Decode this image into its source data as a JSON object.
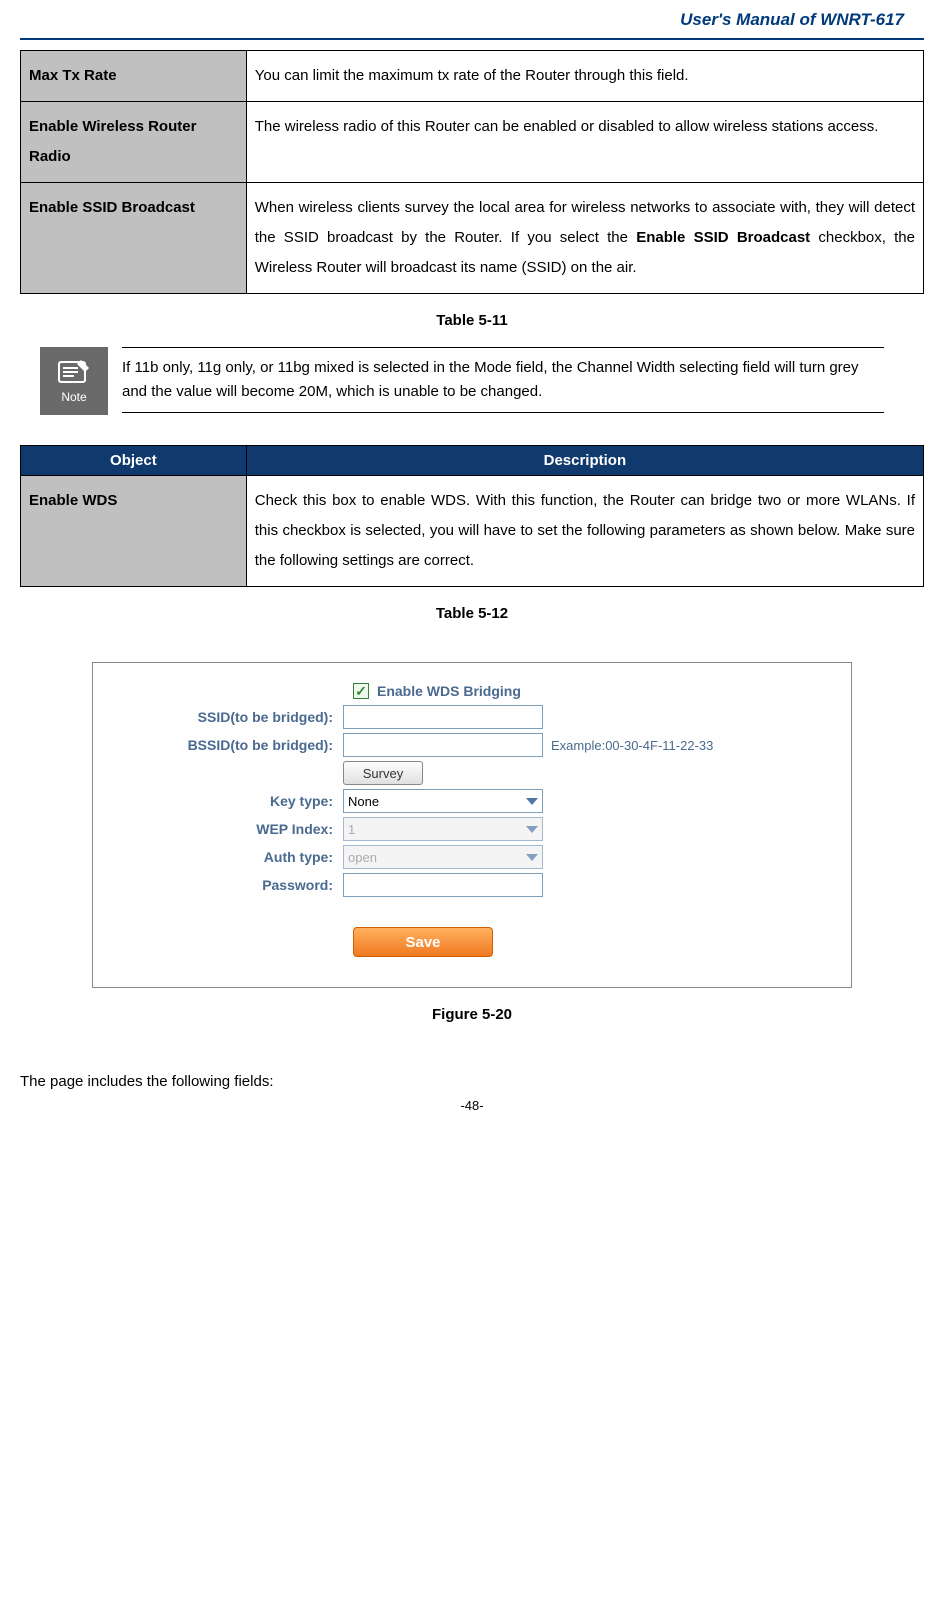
{
  "header_title": "User's Manual of WNRT-617",
  "table1": {
    "rows": [
      {
        "label": "Max Tx Rate",
        "desc_plain": "You can limit the maximum tx rate of the Router through this field."
      },
      {
        "label": "Enable Wireless Router Radio",
        "desc_plain": "The wireless radio of this Router can be enabled or disabled to allow wireless stations access."
      },
      {
        "label": "Enable SSID Broadcast",
        "desc_pre": "When wireless clients survey the local area for wireless networks to associate with, they will detect the SSID broadcast by the Router. If you select the ",
        "desc_bold": "Enable SSID Broadcast",
        "desc_post": " checkbox, the Wireless Router will broadcast its name (SSID) on the air."
      }
    ],
    "caption": "Table 5-11"
  },
  "note": {
    "icon_label": "Note",
    "text": "If 11b only, 11g only, or 11bg mixed is selected in the Mode field, the Channel Width selecting field will turn grey and the value will become 20M, which is unable to be changed."
  },
  "table2": {
    "header_object": "Object",
    "header_desc": "Description",
    "row_label": "Enable WDS",
    "row_desc": "Check this box to enable WDS. With this function, the Router can bridge two or more WLANs. If this checkbox is selected, you will have to set the following parameters as shown below. Make sure the following settings are correct.",
    "caption": "Table  5-12"
  },
  "wds_figure": {
    "enable_label": "Enable WDS Bridging",
    "checked_glyph": "✓",
    "ssid_label": "SSID(to be bridged):",
    "bssid_label": "BSSID(to be bridged):",
    "bssid_value": "",
    "bssid_example": "Example:00-30-4F-11-22-33",
    "survey_label": "Survey",
    "key_type_label": "Key type:",
    "key_type_value": "None",
    "wep_index_label": "WEP Index:",
    "wep_index_value": "1",
    "auth_type_label": "Auth type:",
    "auth_type_value": "open",
    "password_label": "Password:",
    "save_label": "Save",
    "caption": "Figure 5-20"
  },
  "footer_line": "The page includes the following fields:",
  "page_number": "-48-"
}
